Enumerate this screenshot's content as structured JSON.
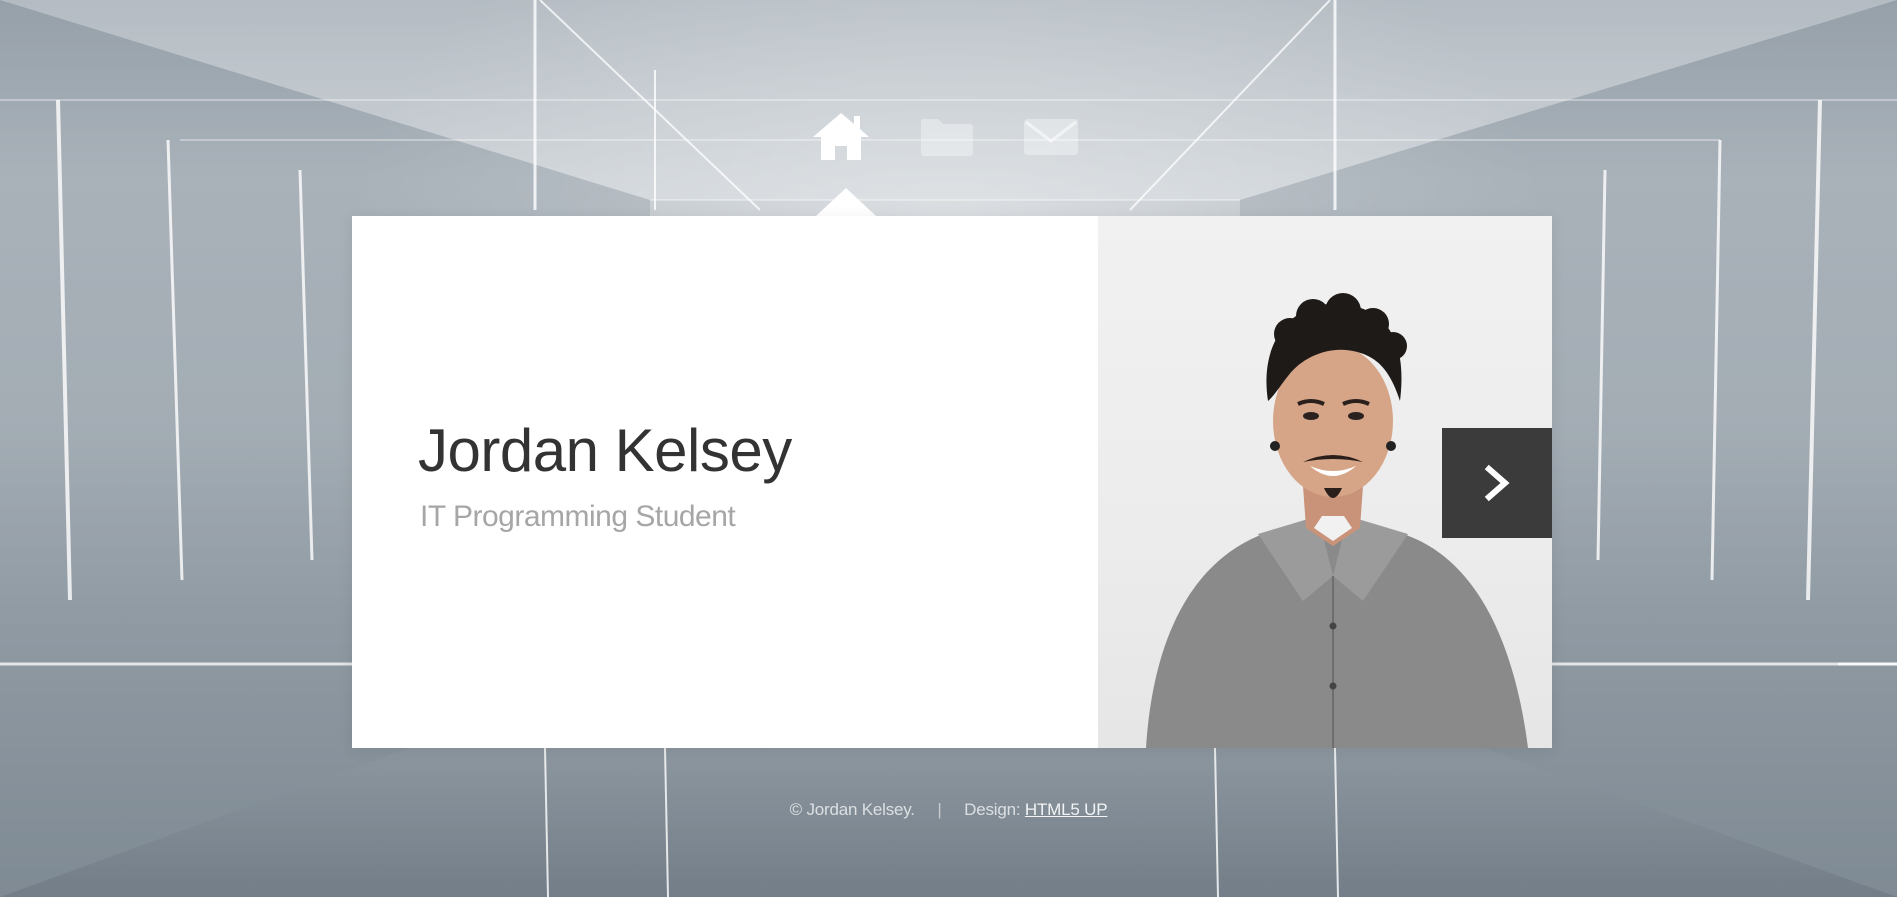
{
  "nav": {
    "items": [
      {
        "icon": "home-icon",
        "active": true
      },
      {
        "icon": "folder-icon",
        "active": false
      },
      {
        "icon": "envelope-icon",
        "active": false
      }
    ]
  },
  "card": {
    "name": "Jordan Kelsey",
    "subtitle": "IT Programming Student",
    "next_icon": "chevron-right-icon"
  },
  "footer": {
    "copyright": "© Jordan Kelsey.",
    "separator": "|",
    "design_label": "Design:",
    "design_link": "HTML5 UP"
  },
  "colors": {
    "card_bg": "#ffffff",
    "name": "#333333",
    "subtitle": "#a6a6a6",
    "next_button": "#3b3b3b",
    "nav_active": "#ffffff",
    "nav_inactive": "rgba(255,255,255,0.35)"
  }
}
